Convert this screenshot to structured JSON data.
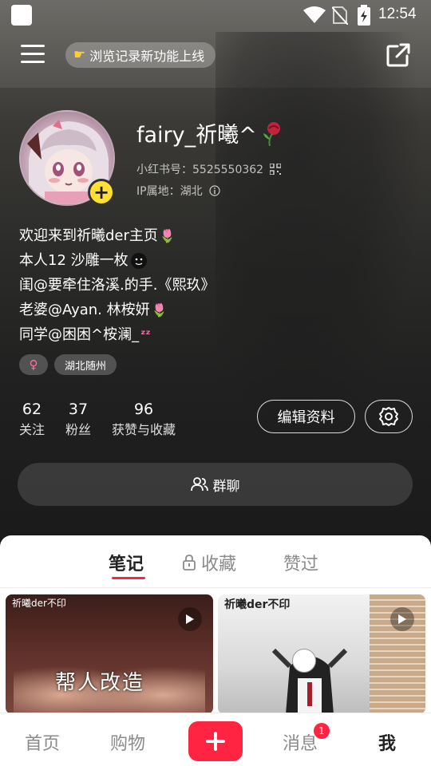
{
  "status_bar": {
    "time": "12:54"
  },
  "header": {
    "banner_text": "浏览记录新功能上线"
  },
  "profile": {
    "username": "fairy_祈曦^",
    "red_id": "小红书号：5525550362",
    "ip_location": "IP属地：湖北",
    "bio_lines": [
      "欢迎来到祈曦der主页",
      "本人12  沙雕一枚",
      "闺@要牵住洛溪.的手.《熙玖》",
      "老婆@Ayan. 林桉妍",
      "同学@困困^桉澜_"
    ],
    "tags": {
      "location": "湖北随州"
    }
  },
  "stats": [
    {
      "value": "62",
      "label": "关注"
    },
    {
      "value": "37",
      "label": "粉丝"
    },
    {
      "value": "96",
      "label": "获赞与收藏"
    }
  ],
  "buttons": {
    "edit_profile": "编辑资料",
    "group_chat": "群聊"
  },
  "content_tabs": [
    {
      "label": "笔记"
    },
    {
      "label": "收藏"
    },
    {
      "label": "赞过"
    }
  ],
  "notes": [
    {
      "caption": "祈曦der不印",
      "overlay_text": "帮人改造"
    },
    {
      "caption": "祈曦der不印"
    }
  ],
  "bottom_nav": {
    "home": "首页",
    "shop": "购物",
    "messages": "消息",
    "messages_badge": "1",
    "me": "我"
  },
  "colors": {
    "accent": "#ff2442",
    "add_badge": "#ffe033"
  }
}
